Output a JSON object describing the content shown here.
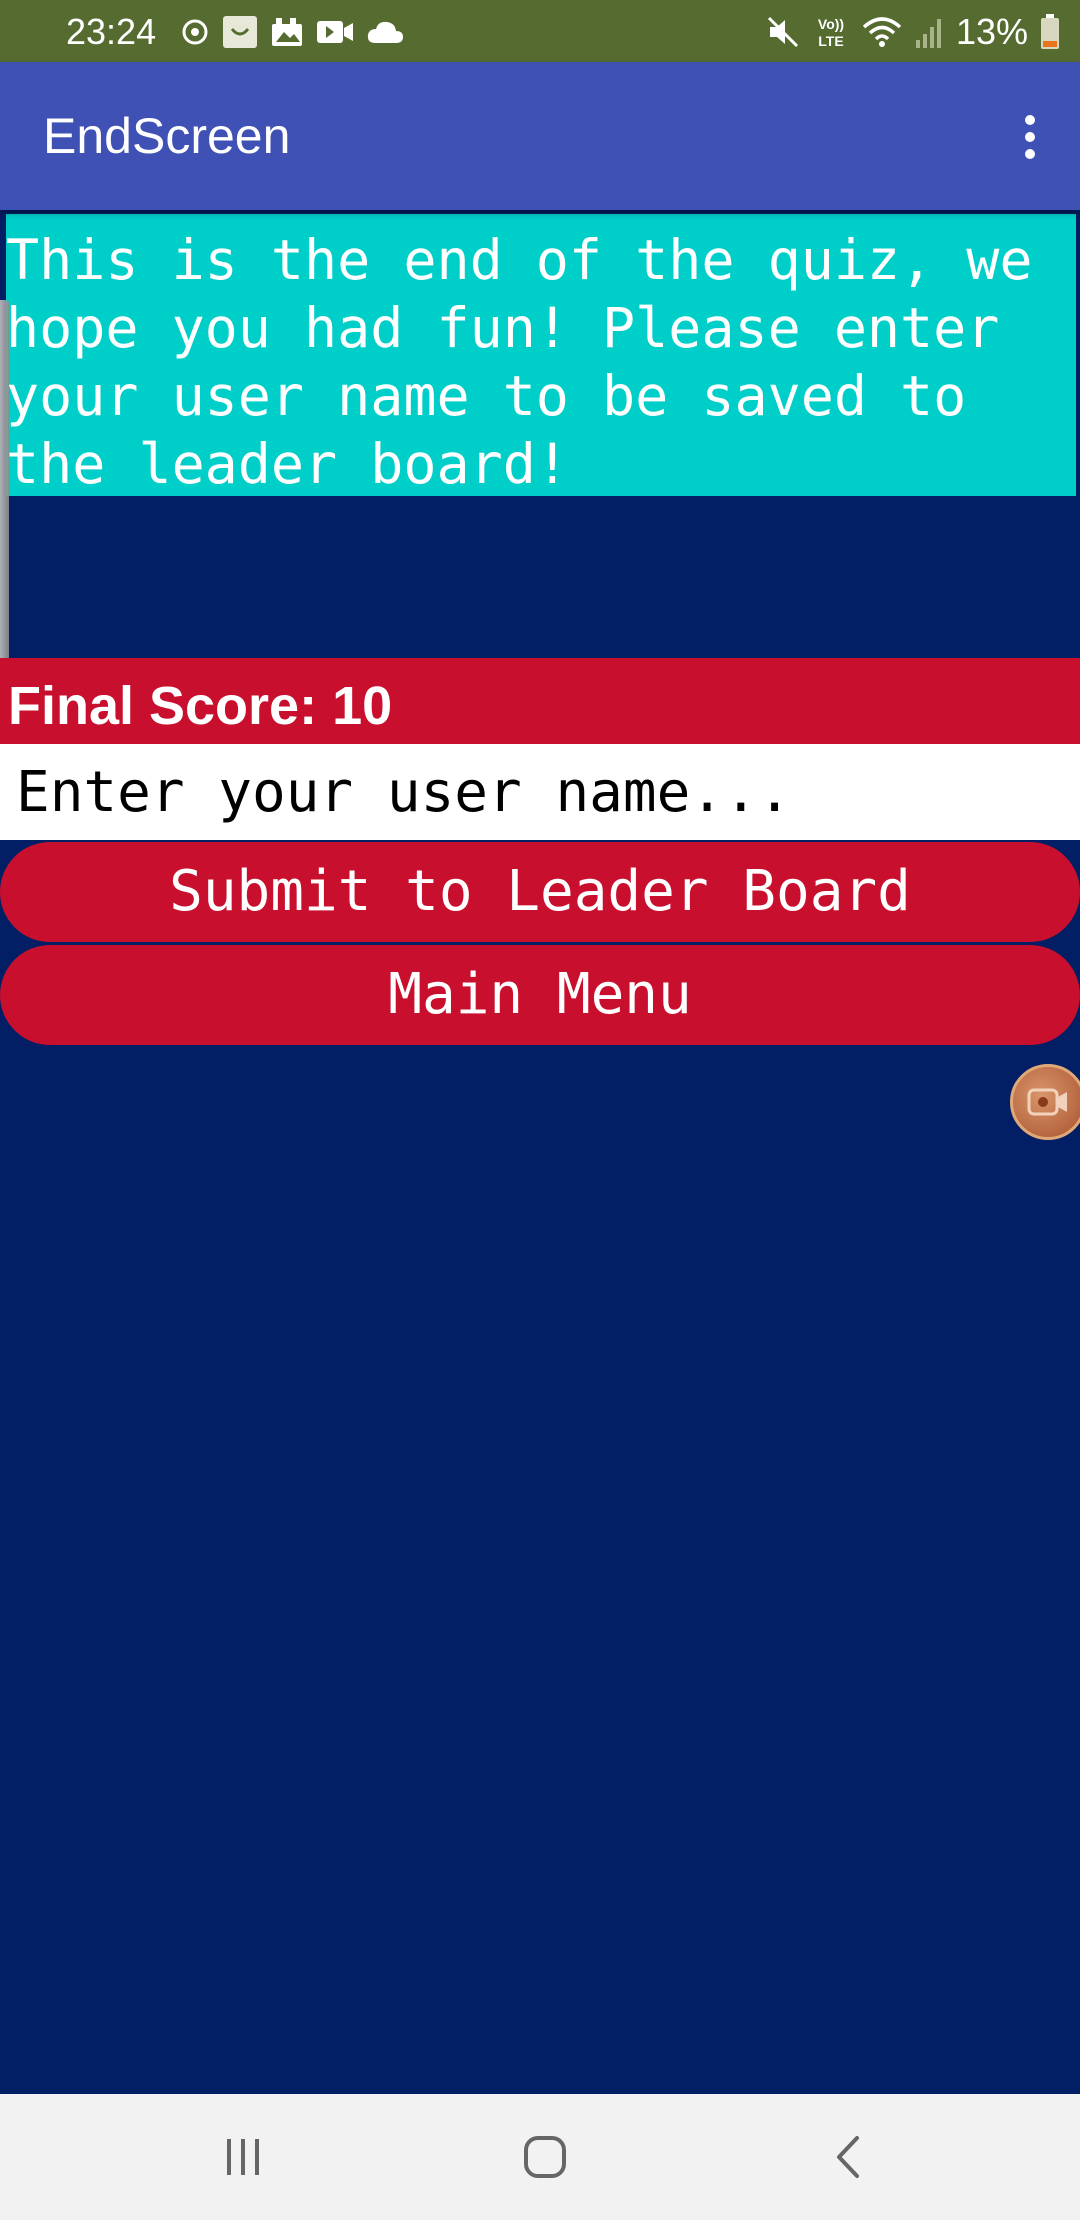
{
  "status_bar": {
    "time": "23:24",
    "network_label": "Vo) LTE",
    "battery_percent": "13%",
    "icons_left": [
      "sync-icon",
      "app-notification-icon",
      "photo-gallery-icon",
      "video-icon",
      "cloud-icon"
    ],
    "icons_right": [
      "mute-icon",
      "volte-icon",
      "wifi-icon",
      "signal-icon",
      "battery-icon"
    ],
    "color": "#556b2f"
  },
  "app_bar": {
    "title": "EndScreen",
    "menu_icon": "overflow-menu-icon",
    "color": "#3f51b5"
  },
  "content": {
    "intro_text": "This is the end of the quiz, we hope you had fun! Please enter your user name to be saved to the leader board!",
    "intro_bg": "#00cec9",
    "score_label": "Final Score: 10",
    "accent": "#c8102e",
    "background": "#021e64"
  },
  "name_input": {
    "value": "",
    "placeholder": "Enter your user name..."
  },
  "buttons": {
    "submit_label": "Submit to Leader Board",
    "main_menu_label": "Main Menu"
  },
  "overlay": {
    "record_icon": "screen-record-icon"
  },
  "nav_bar": {
    "icons": [
      "recent-apps-icon",
      "home-icon",
      "back-icon"
    ]
  }
}
